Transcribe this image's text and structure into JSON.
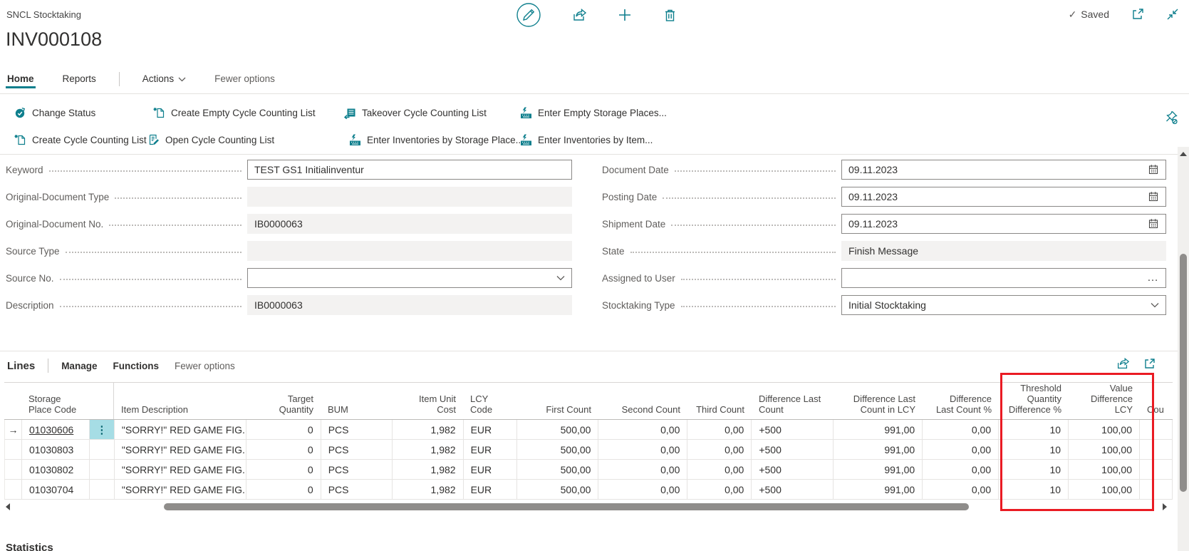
{
  "colors": {
    "accent": "#0e7f8d",
    "annotation_red": "#ea1b23",
    "selected_cell": "#a6dde5"
  },
  "header": {
    "caption": "SNCL Stocktaking",
    "title": "INV000108",
    "saved_label": "Saved"
  },
  "tabs": {
    "home": "Home",
    "reports": "Reports",
    "actions": "Actions",
    "fewer_options": "Fewer options"
  },
  "ribbon": {
    "rows": [
      {
        "items": [
          {
            "label": "Change Status",
            "icon": "status-change-icon"
          },
          {
            "label": "Create Empty Cycle Counting List",
            "icon": "new-document-icon"
          },
          {
            "label": "Takeover Cycle Counting List",
            "icon": "takeover-list-icon"
          },
          {
            "label": "Enter Empty Storage Places...",
            "icon": "enter-keyboard-icon"
          }
        ]
      },
      {
        "items": [
          {
            "label": "Create Cycle Counting List",
            "icon": "new-document-icon"
          },
          {
            "label": "Open Cycle Counting List",
            "icon": "edit-document-icon"
          },
          {
            "label": "Enter Inventories by Storage Place...",
            "icon": "enter-keyboard-icon"
          },
          {
            "label": "Enter Inventories by Item...",
            "icon": "enter-keyboard-icon"
          }
        ]
      }
    ]
  },
  "form": {
    "left": [
      {
        "label": "Keyword",
        "value": "TEST GS1 Initialinventur",
        "type": "text"
      },
      {
        "label": "Original-Document Type",
        "value": "",
        "type": "disabled"
      },
      {
        "label": "Original-Document No.",
        "value": "IB0000063",
        "type": "disabled"
      },
      {
        "label": "Source Type",
        "value": "",
        "type": "disabled"
      },
      {
        "label": "Source No.",
        "value": "",
        "type": "dropdown"
      },
      {
        "label": "Description",
        "value": "IB0000063",
        "type": "disabled"
      }
    ],
    "right": [
      {
        "label": "Document Date",
        "value": "09.11.2023",
        "type": "date"
      },
      {
        "label": "Posting Date",
        "value": "09.11.2023",
        "type": "date"
      },
      {
        "label": "Shipment Date",
        "value": "09.11.2023",
        "type": "date"
      },
      {
        "label": "State",
        "value": "Finish Message",
        "type": "disabled"
      },
      {
        "label": "Assigned to User",
        "value": "",
        "type": "lookup"
      },
      {
        "label": "Stocktaking Type",
        "value": "Initial Stocktaking",
        "type": "dropdown"
      }
    ]
  },
  "lines": {
    "title": "Lines",
    "menu": {
      "manage": "Manage",
      "functions": "Functions",
      "fewer_options": "Fewer options"
    },
    "columns": [
      "",
      "Storage Place Code",
      "",
      "Item Description",
      "Target Quantity",
      "BUM",
      "Item Unit Cost",
      "LCY Code",
      "First Count",
      "Second Count",
      "Third Count",
      "Difference Last Count",
      "Difference Last Count in LCY",
      "Difference Last Count %",
      "Threshold Quantity Difference %",
      "Threshold Value Difference LCY",
      "Cou"
    ],
    "rows": [
      {
        "current": true,
        "code": "01030606",
        "description": "\"SORRY!\" RED GAME FIG...",
        "target_quantity": "0",
        "bum": "PCS",
        "item_unit_cost": "1,982",
        "lcy_code": "EUR",
        "first_count": "500,00",
        "second_count": "0,00",
        "third_count": "0,00",
        "difference_last_count": "+500",
        "difference_last_count_in_lcy": "991,00",
        "difference_last_count_pct": "0,00",
        "threshold_quantity_difference_pct": "10",
        "threshold_value_difference_lcy": "100,00"
      },
      {
        "current": false,
        "code": "01030803",
        "description": "\"SORRY!\" RED GAME FIG...",
        "target_quantity": "0",
        "bum": "PCS",
        "item_unit_cost": "1,982",
        "lcy_code": "EUR",
        "first_count": "500,00",
        "second_count": "0,00",
        "third_count": "0,00",
        "difference_last_count": "+500",
        "difference_last_count_in_lcy": "991,00",
        "difference_last_count_pct": "0,00",
        "threshold_quantity_difference_pct": "10",
        "threshold_value_difference_lcy": "100,00"
      },
      {
        "current": false,
        "code": "01030802",
        "description": "\"SORRY!\" RED GAME FIG...",
        "target_quantity": "0",
        "bum": "PCS",
        "item_unit_cost": "1,982",
        "lcy_code": "EUR",
        "first_count": "500,00",
        "second_count": "0,00",
        "third_count": "0,00",
        "difference_last_count": "+500",
        "difference_last_count_in_lcy": "991,00",
        "difference_last_count_pct": "0,00",
        "threshold_quantity_difference_pct": "10",
        "threshold_value_difference_lcy": "100,00"
      },
      {
        "current": false,
        "code": "01030704",
        "description": "\"SORRY!\" RED GAME FIG...",
        "target_quantity": "0",
        "bum": "PCS",
        "item_unit_cost": "1,982",
        "lcy_code": "EUR",
        "first_count": "500,00",
        "second_count": "0,00",
        "third_count": "0,00",
        "difference_last_count": "+500",
        "difference_last_count_in_lcy": "991,00",
        "difference_last_count_pct": "0,00",
        "threshold_quantity_difference_pct": "10",
        "threshold_value_difference_lcy": "100,00"
      }
    ]
  },
  "statistics_label": "Statistics"
}
